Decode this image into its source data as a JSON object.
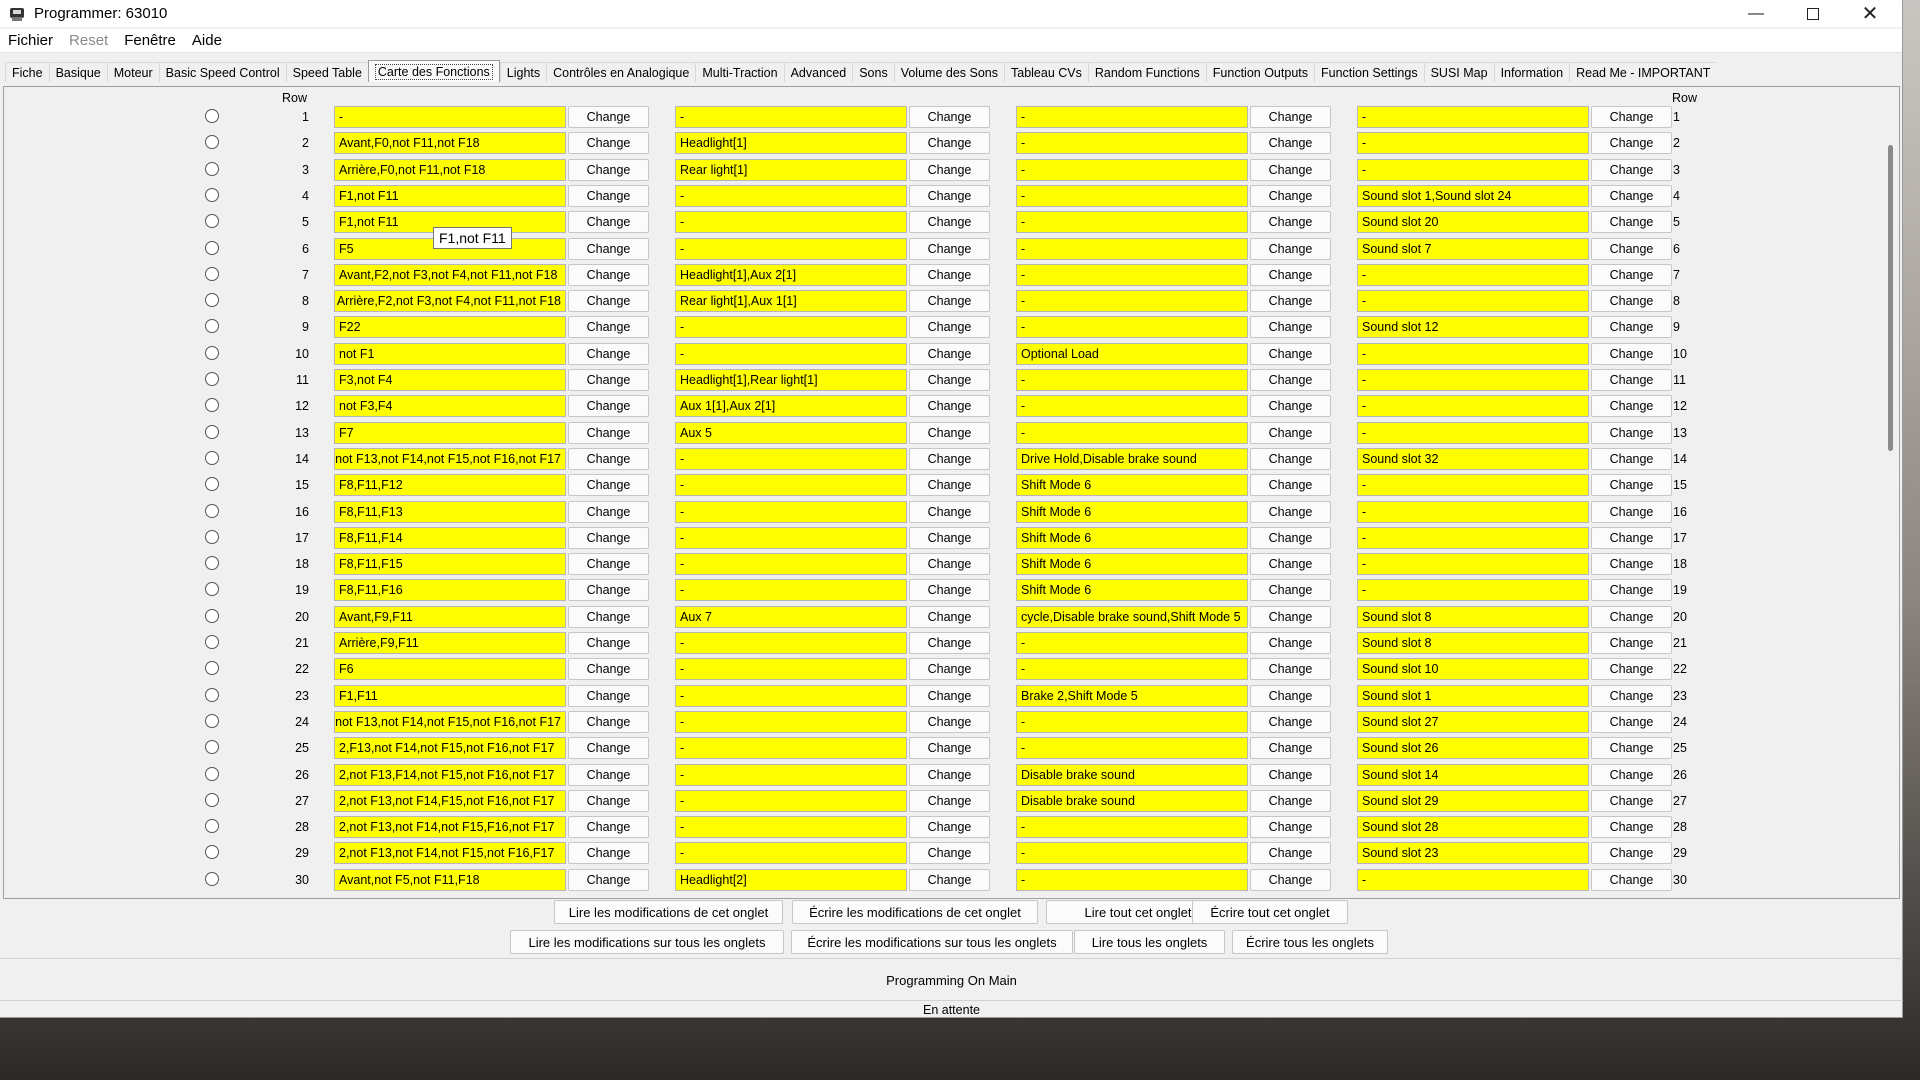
{
  "window": {
    "title": "Programmer: 63010"
  },
  "menu": [
    {
      "label": "Fichier",
      "disabled": false
    },
    {
      "label": "Reset",
      "disabled": true
    },
    {
      "label": "Fenêtre",
      "disabled": false
    },
    {
      "label": "Aide",
      "disabled": false
    }
  ],
  "tabs": [
    "Fiche",
    "Basique",
    "Moteur",
    "Basic Speed Control",
    "Speed Table",
    "Carte des Fonctions",
    "Lights",
    "Contrôles en Analogique",
    "Multi-Traction",
    "Advanced",
    "Sons",
    "Volume des Sons",
    "Tableau CVs",
    "Random Functions",
    "Function Outputs",
    "Function Settings",
    "SUSI Map",
    "Information",
    "Read Me - IMPORTANT"
  ],
  "active_tab": "Carte des Fonctions",
  "table": {
    "row_header": "Row",
    "button_label": "Change",
    "rows": [
      {
        "n": "1",
        "c1": "-",
        "c2": "-",
        "c3": "-",
        "c4": "-"
      },
      {
        "n": "2",
        "c1": "Avant,F0,not F11,not F18",
        "c2": "Headlight[1]",
        "c3": "-",
        "c4": "-"
      },
      {
        "n": "3",
        "c1": "Arrière,F0,not F11,not F18",
        "c2": "Rear light[1]",
        "c3": "-",
        "c4": "-"
      },
      {
        "n": "4",
        "c1": "F1,not F11",
        "c2": "-",
        "c3": "-",
        "c4": "Sound slot 1,Sound slot 24"
      },
      {
        "n": "5",
        "c1": "F1,not F11",
        "c2": "-",
        "c3": "-",
        "c4": "Sound slot 20"
      },
      {
        "n": "6",
        "c1": "F5",
        "c2": "-",
        "c3": "-",
        "c4": "Sound slot 7"
      },
      {
        "n": "7",
        "c1": "Avant,F2,not F3,not F4,not F11,not F18",
        "c2": "Headlight[1],Aux 2[1]",
        "c3": "-",
        "c4": "-"
      },
      {
        "n": "8",
        "c1": "Arrière,F2,not F3,not F4,not F11,not F18",
        "c2": "Rear light[1],Aux 1[1]",
        "c3": "-",
        "c4": "-"
      },
      {
        "n": "9",
        "c1": "F22",
        "c2": "-",
        "c3": "-",
        "c4": "Sound slot 12"
      },
      {
        "n": "10",
        "c1": "not F1",
        "c2": "-",
        "c3": "Optional Load",
        "c4": "-"
      },
      {
        "n": "11",
        "c1": "F3,not F4",
        "c2": "Headlight[1],Rear light[1]",
        "c3": "-",
        "c4": "-"
      },
      {
        "n": "12",
        "c1": "not F3,F4",
        "c2": "Aux 1[1],Aux 2[1]",
        "c3": "-",
        "c4": "-"
      },
      {
        "n": "13",
        "c1": "F7",
        "c2": "Aux 5",
        "c3": "-",
        "c4": "-"
      },
      {
        "n": "14",
        "c1": "not F13,not F14,not F15,not F16,not F17",
        "c2": "-",
        "c3": "Drive Hold,Disable brake sound",
        "c4": "Sound slot 32"
      },
      {
        "n": "15",
        "c1": "F8,F11,F12",
        "c2": "-",
        "c3": "Shift Mode 6",
        "c4": "-"
      },
      {
        "n": "16",
        "c1": "F8,F11,F13",
        "c2": "-",
        "c3": "Shift Mode 6",
        "c4": "-"
      },
      {
        "n": "17",
        "c1": "F8,F11,F14",
        "c2": "-",
        "c3": "Shift Mode 6",
        "c4": "-"
      },
      {
        "n": "18",
        "c1": "F8,F11,F15",
        "c2": "-",
        "c3": "Shift Mode 6",
        "c4": "-"
      },
      {
        "n": "19",
        "c1": "F8,F11,F16",
        "c2": "-",
        "c3": "Shift Mode 6",
        "c4": "-"
      },
      {
        "n": "20",
        "c1": "Avant,F9,F11",
        "c2": "Aux 7",
        "c3": "cycle,Disable brake sound,Shift Mode 5",
        "c4": "Sound slot 8"
      },
      {
        "n": "21",
        "c1": "Arrière,F9,F11",
        "c2": "-",
        "c3": "-",
        "c4": "Sound slot 8"
      },
      {
        "n": "22",
        "c1": "F6",
        "c2": "-",
        "c3": "-",
        "c4": "Sound slot 10"
      },
      {
        "n": "23",
        "c1": "F1,F11",
        "c2": "-",
        "c3": "Brake 2,Shift Mode 5",
        "c4": "Sound slot 1"
      },
      {
        "n": "24",
        "c1": "not F13,not F14,not F15,not F16,not F17",
        "c2": "-",
        "c3": "-",
        "c4": "Sound slot 27"
      },
      {
        "n": "25",
        "c1": "2,F13,not F14,not F15,not F16,not F17",
        "c2": "-",
        "c3": "-",
        "c4": "Sound slot 26"
      },
      {
        "n": "26",
        "c1": "2,not F13,F14,not F15,not F16,not F17",
        "c2": "-",
        "c3": "Disable brake sound",
        "c4": "Sound slot 14"
      },
      {
        "n": "27",
        "c1": "2,not F13,not F14,F15,not F16,not F17",
        "c2": "-",
        "c3": "Disable brake sound",
        "c4": "Sound slot 29"
      },
      {
        "n": "28",
        "c1": "2,not F13,not F14,not F15,F16,not F17",
        "c2": "-",
        "c3": "-",
        "c4": "Sound slot 28"
      },
      {
        "n": "29",
        "c1": "2,not F13,not F14,not F15,not F16,F17",
        "c2": "-",
        "c3": "-",
        "c4": "Sound slot 23"
      },
      {
        "n": "30",
        "c1": "Avant,not F5,not F11,F18",
        "c2": "Headlight[2]",
        "c3": "-",
        "c4": "-"
      }
    ]
  },
  "tooltip": "F1,not F11",
  "actions_row1": [
    "Lire les modifications de cet onglet",
    "Écrire les modifications de cet onglet",
    "Lire tout cet onglet",
    "Écrire tout cet onglet"
  ],
  "actions_row2": [
    "Lire les modifications sur tous les onglets",
    "Écrire les modifications sur tous les onglets",
    "Lire tous les onglets",
    "Écrire tous les onglets"
  ],
  "mode": "Programming On Main",
  "status": "En attente",
  "colors": {
    "field_bg": "#ffff00",
    "window_bg": "#f0f0f0"
  }
}
